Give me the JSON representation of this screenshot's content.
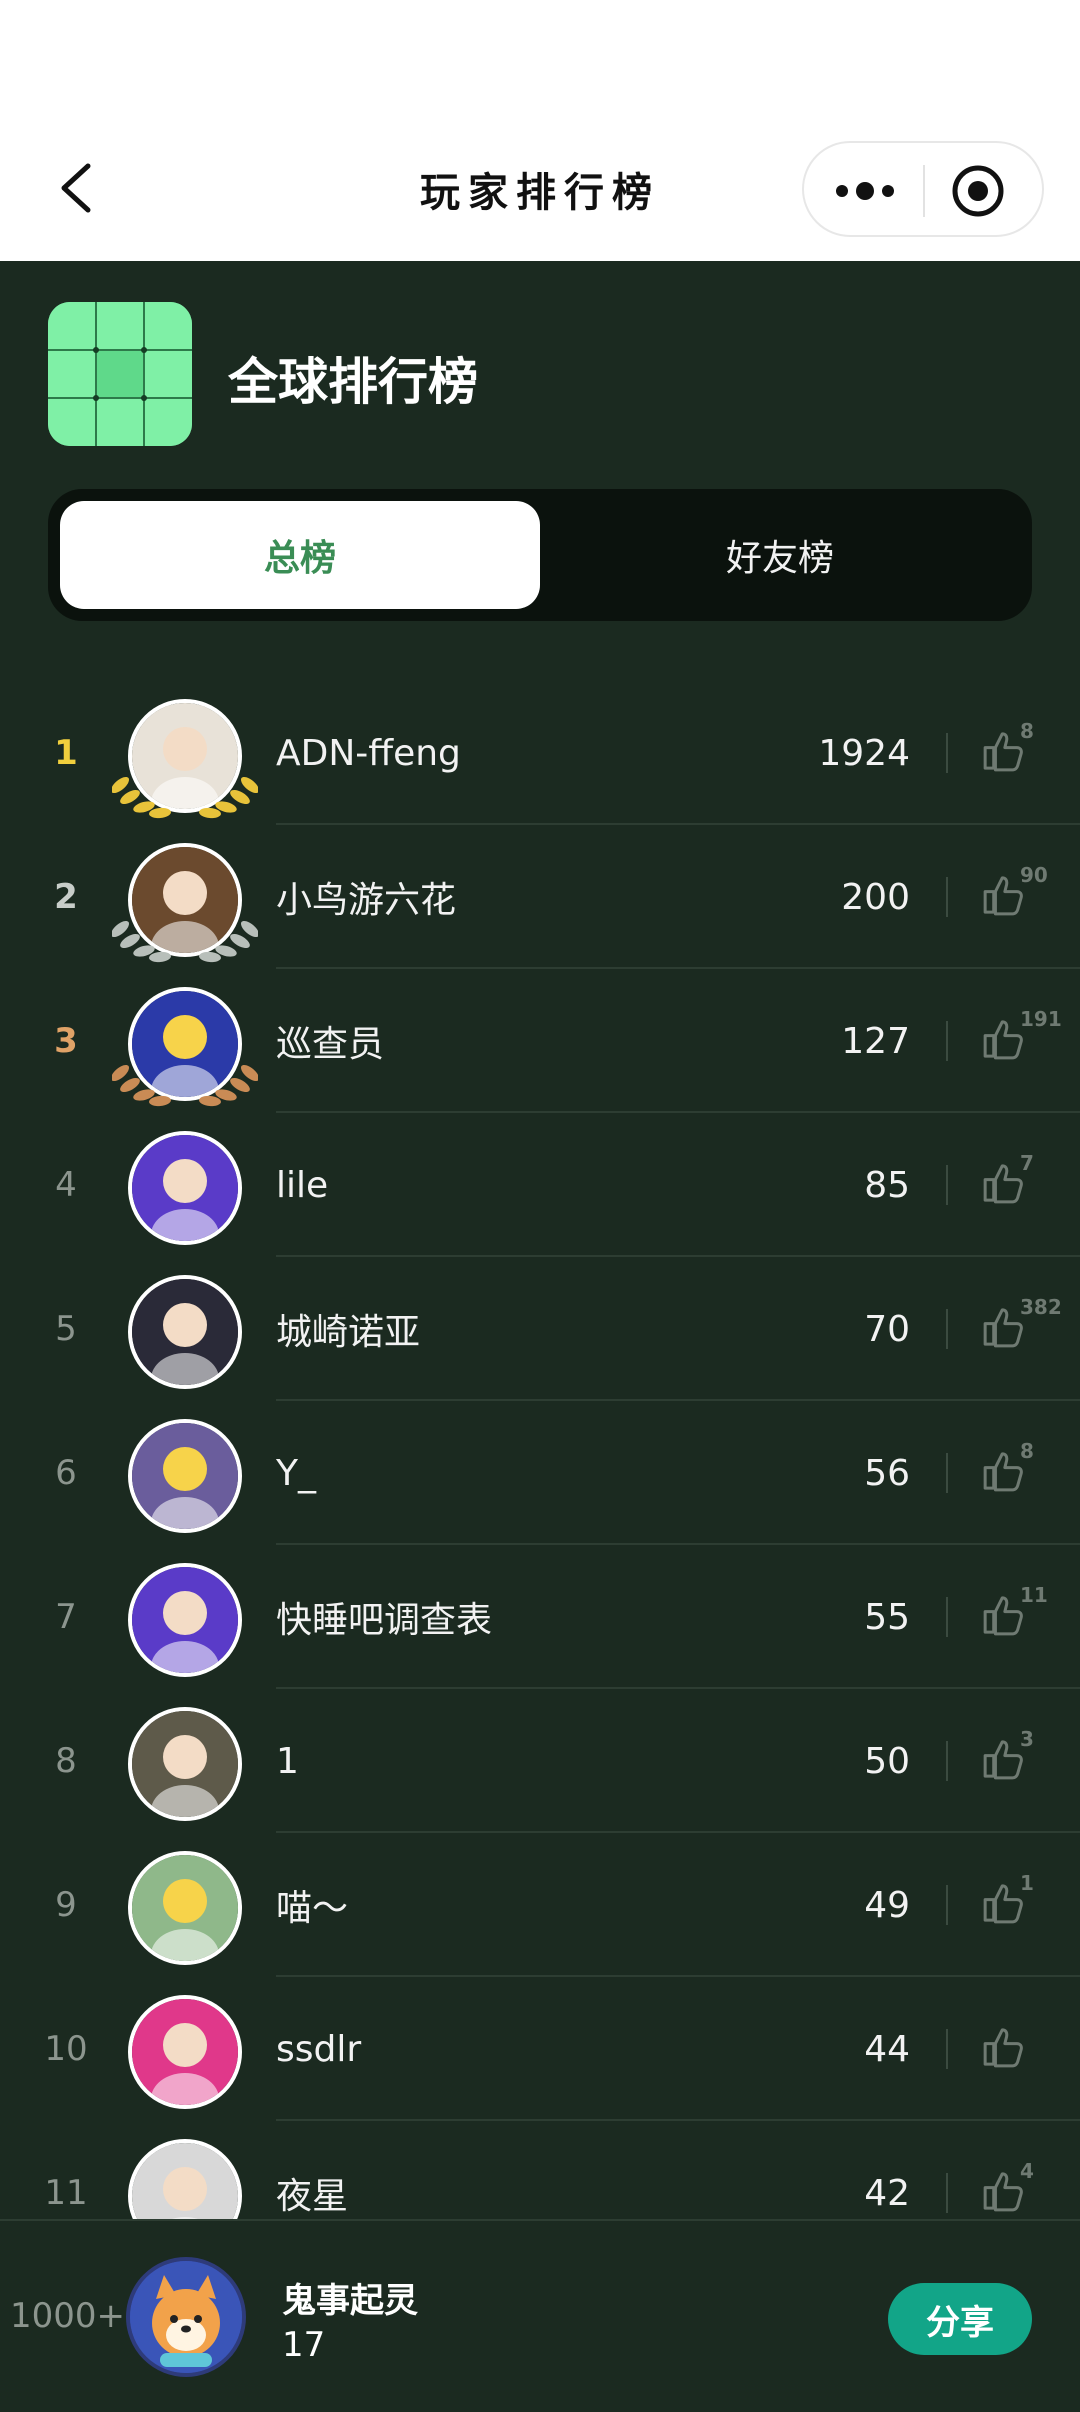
{
  "nav": {
    "title": "玩家排行榜",
    "back_icon": "chevron-left-icon",
    "more_icon": "more-dots-icon",
    "close_icon": "target-circle-icon"
  },
  "header": {
    "icon": "grid-icon",
    "title": "全球排行榜",
    "accent": "#6fe39a"
  },
  "tabs": [
    {
      "label": "总榜",
      "active": true
    },
    {
      "label": "好友榜",
      "active": false
    }
  ],
  "rankings": [
    {
      "rank": "1",
      "name": "ADN-ffeng",
      "score": "1924",
      "likes": "8",
      "medal": "gold",
      "avatar_color": "#e8e2d8"
    },
    {
      "rank": "2",
      "name": "小鸟游六花",
      "score": "200",
      "likes": "90",
      "medal": "silver",
      "avatar_color": "#6b4a2e"
    },
    {
      "rank": "3",
      "name": "巡查员",
      "score": "127",
      "likes": "191",
      "medal": "bronze",
      "avatar_color": "#2b3aa8"
    },
    {
      "rank": "4",
      "name": "lile",
      "score": "85",
      "likes": "7",
      "medal": "",
      "avatar_color": "#5a3bc8"
    },
    {
      "rank": "5",
      "name": "城崎诺亚",
      "score": "70",
      "likes": "382",
      "medal": "",
      "avatar_color": "#2a2a38"
    },
    {
      "rank": "6",
      "name": "Y_",
      "score": "56",
      "likes": "8",
      "medal": "",
      "avatar_color": "#6a5d9c"
    },
    {
      "rank": "7",
      "name": "快睡吧调查表",
      "score": "55",
      "likes": "11",
      "medal": "",
      "avatar_color": "#5a3bc8"
    },
    {
      "rank": "8",
      "name": "1",
      "score": "50",
      "likes": "3",
      "medal": "",
      "avatar_color": "#5e5a4a"
    },
    {
      "rank": "9",
      "name": "喵～",
      "score": "49",
      "likes": "1",
      "medal": "",
      "avatar_color": "#8fb88a"
    },
    {
      "rank": "10",
      "name": "ssdlr",
      "score": "44",
      "likes": "",
      "medal": "",
      "avatar_color": "#e0388a"
    },
    {
      "rank": "11",
      "name": "夜星",
      "score": "42",
      "likes": "4",
      "medal": "",
      "avatar_color": "#d8d8d8"
    }
  ],
  "me": {
    "rank": "1000+",
    "name": "鬼事起灵",
    "score": "17",
    "avatar_color": "#3750b0"
  },
  "share_label": "分享",
  "colors": {
    "background": "#1b2a20",
    "gold": "#f1cf3d",
    "silver": "#c8cdc9",
    "bronze": "#e0a267",
    "share": "#12a588"
  }
}
